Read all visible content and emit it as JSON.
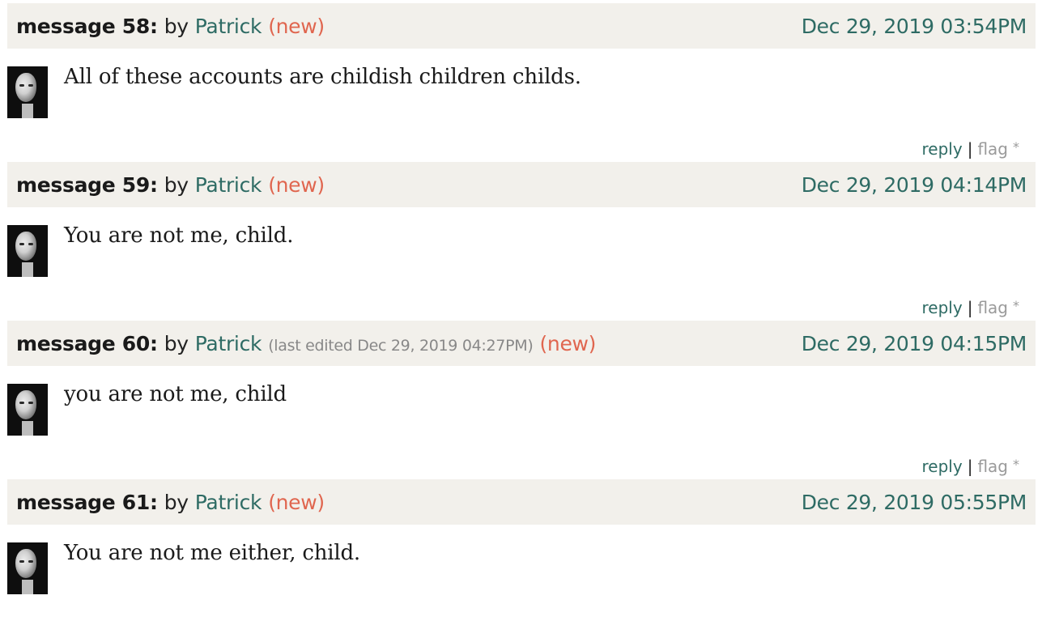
{
  "labels": {
    "by": "by",
    "new": "(new)",
    "reply": "reply",
    "separator": "|",
    "flag": "flag",
    "flag_star": "*"
  },
  "messages": [
    {
      "number": "message 58:",
      "author": "Patrick",
      "edited": "",
      "timestamp": "Dec 29, 2019 03:54PM",
      "body": "All of these accounts are childish children childs."
    },
    {
      "number": "message 59:",
      "author": "Patrick",
      "edited": "",
      "timestamp": "Dec 29, 2019 04:14PM",
      "body": "You are not me, child."
    },
    {
      "number": "message 60:",
      "author": "Patrick",
      "edited": "(last edited Dec 29, 2019 04:27PM)",
      "timestamp": "Dec 29, 2019 04:15PM",
      "body": "you are not me, child"
    },
    {
      "number": "message 61:",
      "author": "Patrick",
      "edited": "",
      "timestamp": "Dec 29, 2019 05:55PM",
      "body": "You are not me either, child."
    }
  ]
}
